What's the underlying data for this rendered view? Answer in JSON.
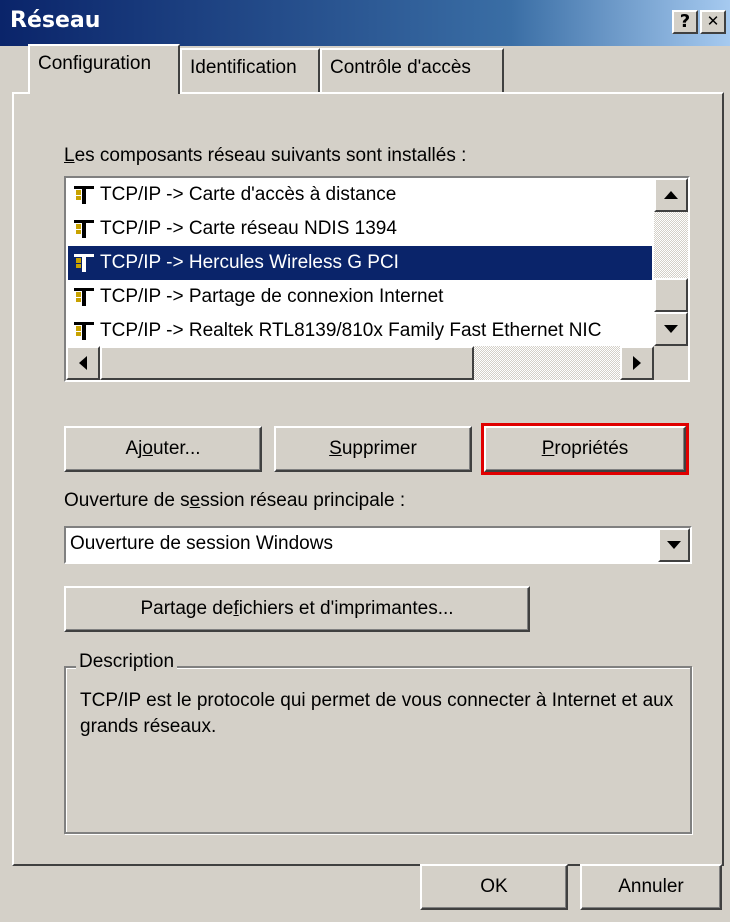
{
  "window": {
    "title": "Réseau",
    "help_label": "?",
    "close_label": "✕"
  },
  "tabs": [
    {
      "label": "Configuration",
      "active": true
    },
    {
      "label": "Identification",
      "active": false
    },
    {
      "label": "Contrôle d'accès",
      "active": false
    }
  ],
  "components": {
    "label_mnemonic": "L",
    "label_rest": "es composants réseau suivants sont installés :",
    "items": [
      {
        "label": "TCP/IP -> Carte d'accès à distance",
        "icon": "network-component-icon",
        "selected": false
      },
      {
        "label": "TCP/IP -> Carte réseau NDIS 1394",
        "icon": "network-component-icon",
        "selected": false
      },
      {
        "label": "TCP/IP -> Hercules Wireless G PCI",
        "icon": "network-component-icon",
        "selected": true
      },
      {
        "label": "TCP/IP -> Partage de connexion Internet",
        "icon": "network-component-icon",
        "selected": false
      },
      {
        "label": "TCP/IP -> Realtek RTL8139/810x Family Fast Ethernet NIC",
        "icon": "network-component-icon",
        "selected": false
      }
    ]
  },
  "buttons": {
    "add_pre": "Aj",
    "add_mn": "o",
    "add_post": "uter...",
    "remove_pre": "",
    "remove_mn": "S",
    "remove_post": "upprimer",
    "props_pre": "",
    "props_mn": "P",
    "props_post": "ropriétés",
    "share_pre": "Partage de ",
    "share_mn": "f",
    "share_post": "ichiers et d'imprimantes...",
    "ok": "OK",
    "cancel": "Annuler"
  },
  "logon": {
    "label_pre": "Ouverture de s",
    "label_mn": "e",
    "label_post": "ssion réseau principale :",
    "value": "Ouverture de session Windows"
  },
  "description": {
    "legend": "Description",
    "text": "TCP/IP est le protocole qui permet de vous connecter à Internet et aux grands réseaux."
  },
  "colors": {
    "selection": "#0a246a",
    "highlight_border": "#e00000",
    "face": "#d4d0c8"
  }
}
